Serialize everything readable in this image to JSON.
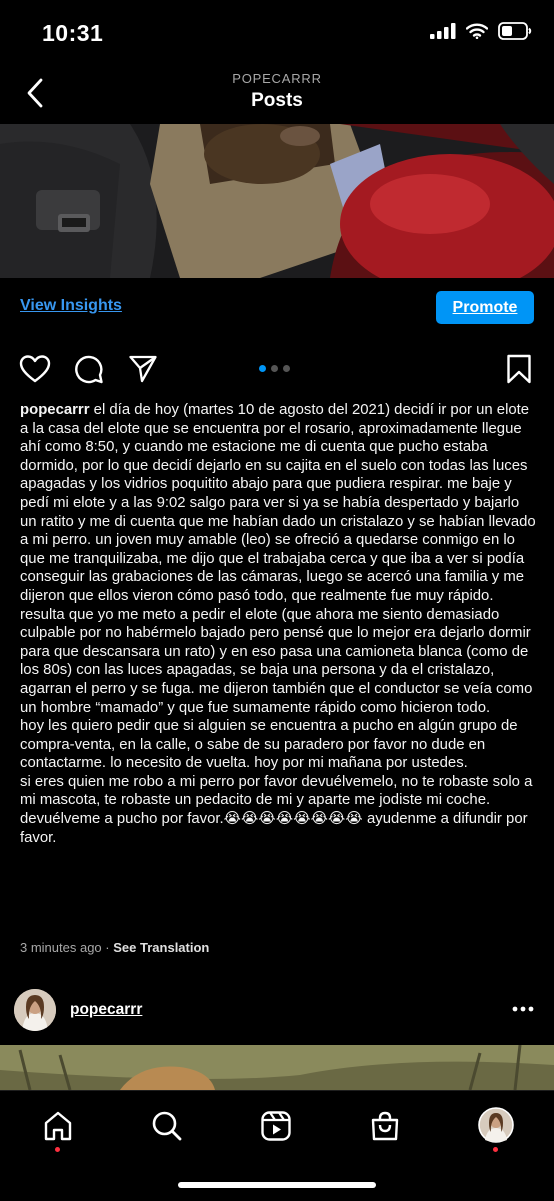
{
  "status_bar": {
    "time": "10:31",
    "icons": [
      "signal-icon",
      "wifi-icon",
      "battery-icon"
    ]
  },
  "header": {
    "username": "POPECARRR",
    "title": "Posts",
    "back_icon": "chevron-left-icon"
  },
  "insights": {
    "view_label": "View Insights",
    "promote_label": "Promote"
  },
  "actions": {
    "icons": [
      "heart-icon",
      "comment-icon",
      "share-icon",
      "bookmark-icon"
    ],
    "carousel": {
      "count": 3,
      "active_index": 0
    }
  },
  "caption": {
    "username": "popecarrr",
    "paragraph1": "el día de hoy (martes 10 de agosto del 2021) decidí ir por un elote a la casa del elote que se encuentra por el rosario, aproximadamente llegue ahí como 8:50, y cuando me estacione me di cuenta que pucho estaba dormido, por lo que decidí dejarlo en su cajita en el suelo con todas las luces apagadas y los vidrios poquitito abajo para que pudiera respirar. me baje y pedí mi elote y a las 9:02 salgo para ver si ya se había despertado y bajarlo un ratito y me di cuenta que me habían dado un cristalazo y se habían llevado a mi perro. un joven muy amable (leo) se ofreció a quedarse conmigo en lo que me tranquilizaba, me dijo que el trabajaba cerca y que iba a ver si podía conseguir las grabaciones de las cámaras, luego se acercó una familia y me dijeron que ellos vieron cómo pasó todo, que realmente fue muy rápido. resulta que yo me meto a pedir el elote (que ahora me siento demasiado culpable por no habérmelo bajado pero pensé que lo mejor era dejarlo dormir para que descansara un rato) y en eso pasa una camioneta blanca (como de los 80s) con las luces apagadas, se baja una persona y da el cristalazo, agarran el perro y se fuga. me dijeron también que el conductor se veía como un hombre “mamado” y que fue sumamente rápido como hicieron todo.",
    "paragraph2": "hoy les quiero pedir que si alguien se encuentra a pucho en algún grupo de compra-venta, en la calle, o sabe de su paradero por favor no dude en contactarme. lo necesito de vuelta. hoy por mi mañana por ustedes.",
    "paragraph3": "si eres quien me robo a mi perro por favor devuélvemelo, no te robaste solo a mi mascota, te robaste un pedacito de mi y aparte me jodiste mi coche. devuélveme a pucho por favor.😭😭😭😭😭😭😭😭 ayudenme a difundir por favor."
  },
  "meta": {
    "time_ago": "3 minutes ago",
    "separator": "·",
    "see_translation": "See Translation"
  },
  "next_post": {
    "username": "popecarrr",
    "more_icon": "more-horizontal-icon"
  },
  "bottom_nav": {
    "items": [
      "home-icon",
      "search-icon",
      "reels-icon",
      "shop-icon",
      "profile-avatar"
    ],
    "active": "home-icon",
    "accent": "#ff3040"
  },
  "colors": {
    "background": "#000000",
    "link": "#3897f0",
    "button": "#0095f6",
    "muted": "#a8a8a8"
  }
}
